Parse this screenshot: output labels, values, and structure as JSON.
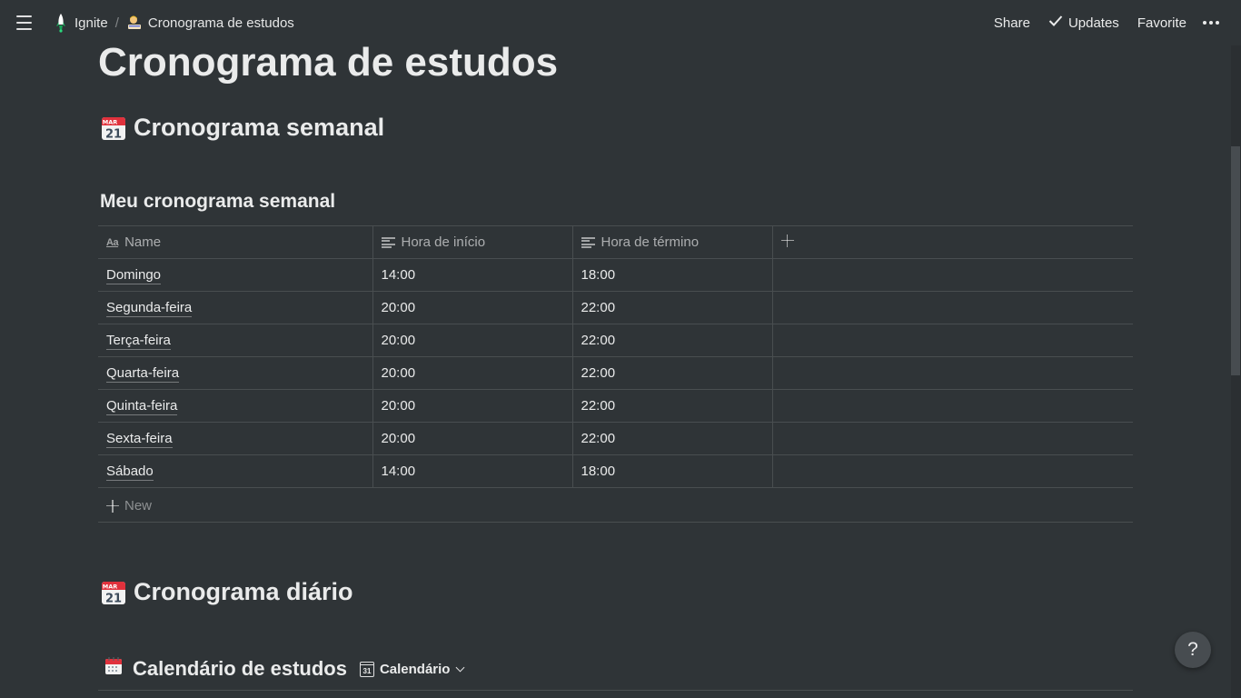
{
  "topbar": {
    "workspace": "Ignite",
    "separator": "/",
    "page": "Cronograma de estudos",
    "share": "Share",
    "updates": "Updates",
    "favorite": "Favorite"
  },
  "page": {
    "title": "Cronograma de estudos"
  },
  "sections": {
    "weekly_heading": "Cronograma semanal",
    "daily_heading": "Cronograma diário"
  },
  "weekly_db": {
    "title": "Meu cronograma semanal",
    "columns": [
      "Name",
      "Hora de início",
      "Hora de término"
    ],
    "rows": [
      {
        "name": "Domingo",
        "start": "14:00",
        "end": "18:00"
      },
      {
        "name": "Segunda-feira",
        "start": "20:00",
        "end": "22:00"
      },
      {
        "name": "Terça-feira",
        "start": "20:00",
        "end": "22:00"
      },
      {
        "name": "Quarta-feira",
        "start": "20:00",
        "end": "22:00"
      },
      {
        "name": "Quinta-feira",
        "start": "20:00",
        "end": "22:00"
      },
      {
        "name": "Sexta-feira",
        "start": "20:00",
        "end": "22:00"
      },
      {
        "name": "Sábado",
        "start": "14:00",
        "end": "18:00"
      }
    ],
    "new_label": "New"
  },
  "calendar_db": {
    "title": "Calendário de estudos",
    "view_label": "Calendário",
    "view_icon_text": "31"
  },
  "calendar_icon_text": {
    "month": "MAR",
    "day": "21"
  },
  "help": "?",
  "icons": {
    "menu": "hamburger-icon",
    "workspace": "rocket-icon",
    "page": "person-studying-icon",
    "updates": "check-icon",
    "more": "more-dots-icon",
    "heading": "calendar-icon",
    "name_column": "text-aa-icon",
    "text_column": "text-lines-icon",
    "add_column": "plus-icon",
    "calendar_db": "spiral-calendar-icon",
    "view": "calendar-view-icon",
    "dropdown": "chevron-down-icon"
  },
  "colors": {
    "background": "#2f3437",
    "accent_red": "#e0313c"
  }
}
